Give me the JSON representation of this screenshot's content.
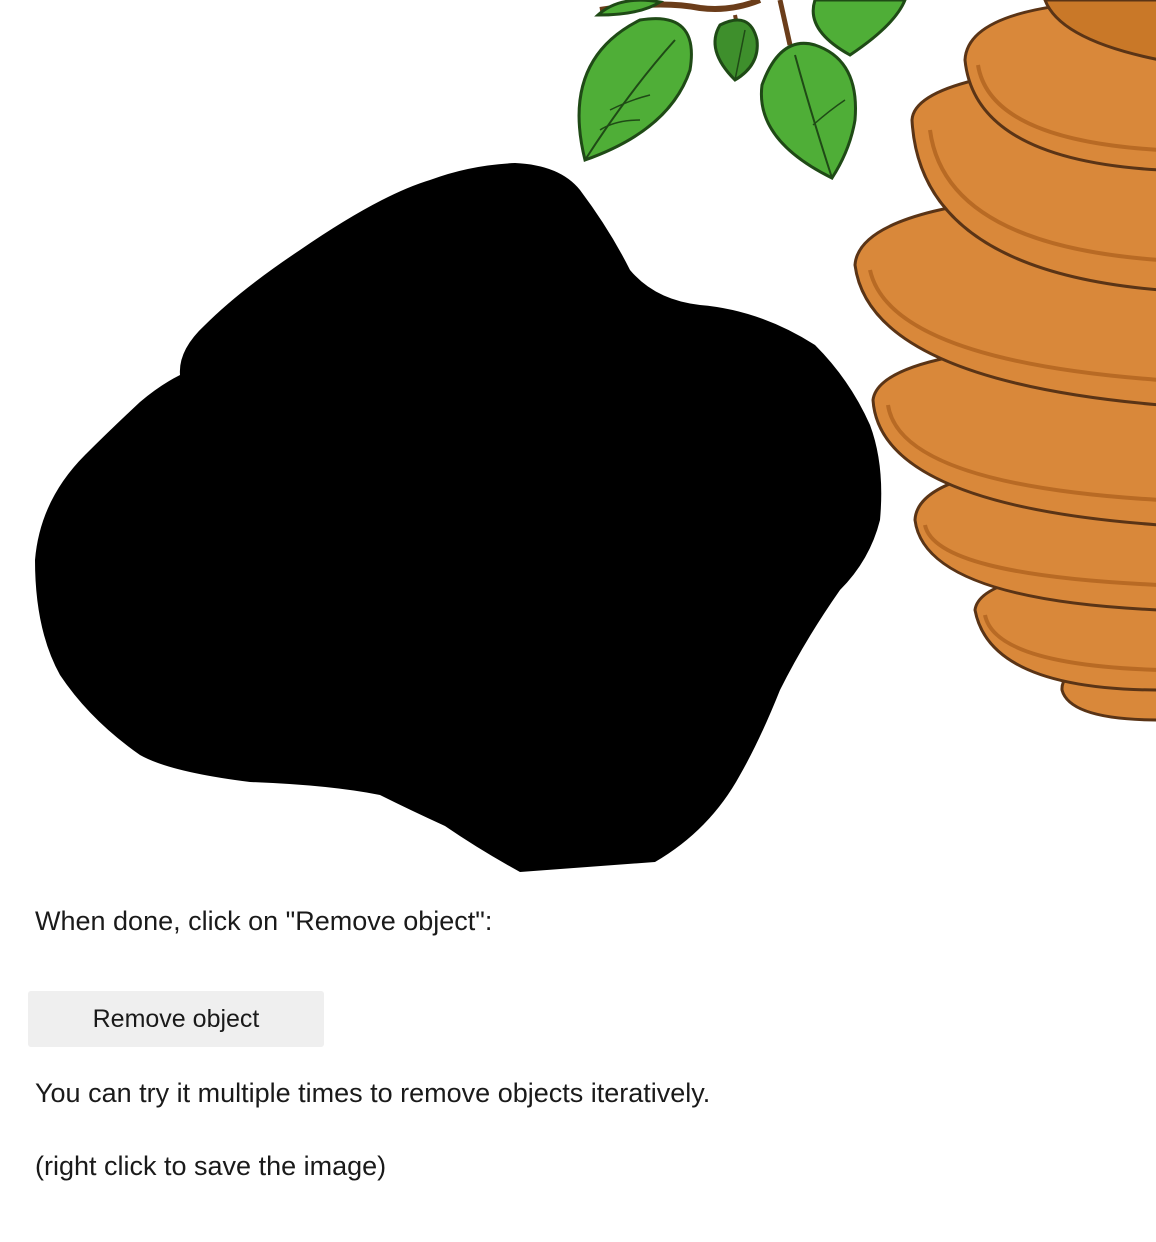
{
  "editor": {
    "canvas": {
      "mask_color": "#000000",
      "leaf_color": "#4fae37",
      "leaf_dark_color": "#2f7d24",
      "hive_color": "#d9883a",
      "hive_shade_color": "#b86a24",
      "hive_outline_color": "#5a3416"
    },
    "instruction_text": "When done, click on \"Remove object\":",
    "remove_button_label": "Remove object",
    "hint_text": "You can try it multiple times to remove objects iteratively.",
    "save_note_text": "(right click to save the image)"
  }
}
